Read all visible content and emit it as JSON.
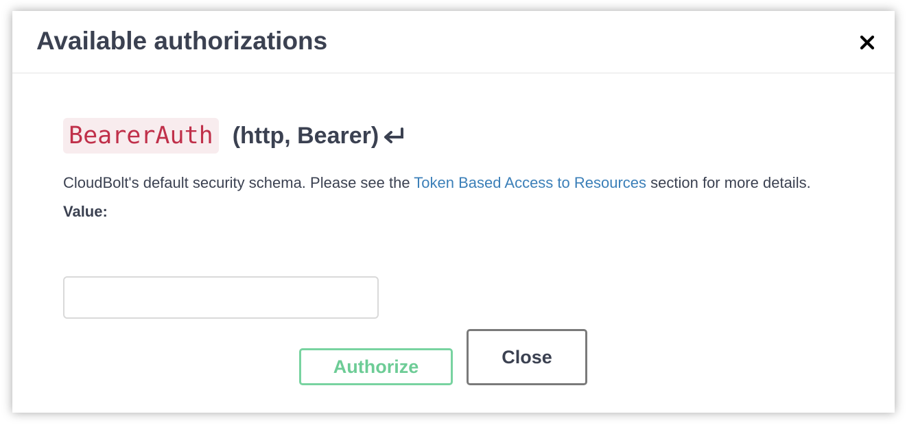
{
  "modal": {
    "title": "Available authorizations",
    "close_icon": "close-icon"
  },
  "auth": {
    "scheme_name": "BearerAuth",
    "scheme_type": "(http, Bearer)",
    "return_icon": "enter-return-icon",
    "description_prefix": "CloudBolt's default security schema. Please see the ",
    "description_link": "Token Based Access to Resources",
    "description_suffix": " section for more details.",
    "value_label": "Value:",
    "value_input_value": "",
    "value_input_placeholder": ""
  },
  "buttons": {
    "authorize_label": "Authorize",
    "close_label": "Close"
  },
  "colors": {
    "title_text": "#3b4151",
    "scheme_name_text": "#c0304a",
    "scheme_name_bg": "#f8ecee",
    "link": "#3b7fb8",
    "authorize_border": "#78d3a0",
    "authorize_text": "#6dcc96",
    "close_border": "#7a7a7a"
  }
}
